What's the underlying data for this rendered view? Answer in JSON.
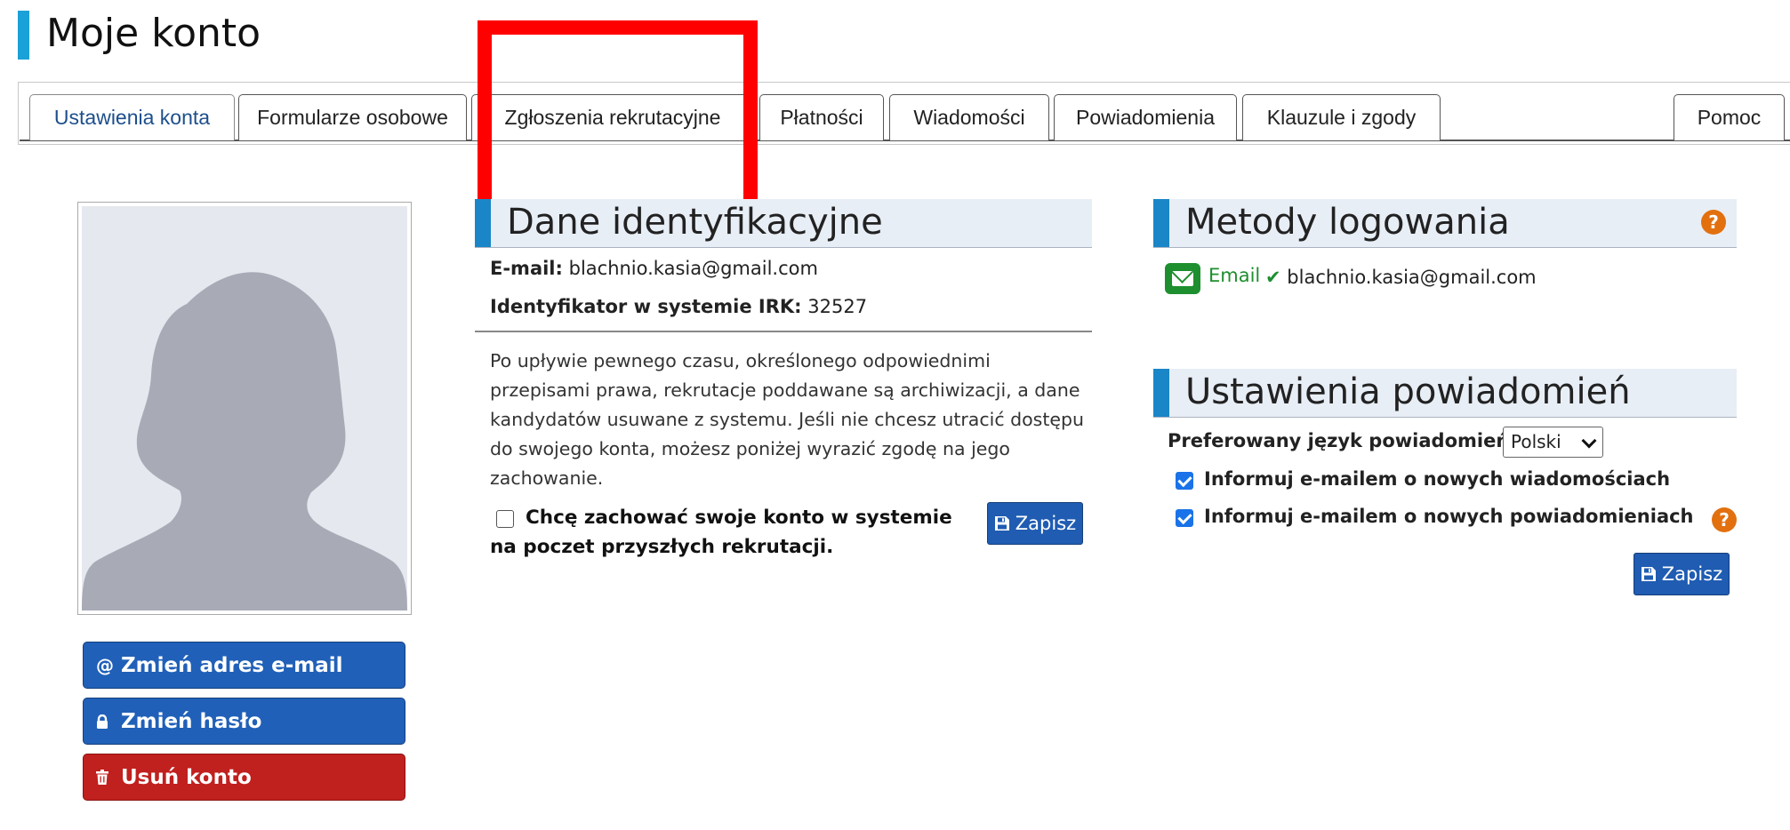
{
  "page_title": "Moje konto",
  "tabs": [
    {
      "label": "Ustawienia konta"
    },
    {
      "label": "Formularze osobowe"
    },
    {
      "label": "Zgłoszenia rekrutacyjne"
    },
    {
      "label": "Płatności"
    },
    {
      "label": "Wiadomości"
    },
    {
      "label": "Powiadomienia"
    },
    {
      "label": "Klauzule i zgody"
    },
    {
      "label": "Pomoc"
    }
  ],
  "left_buttons": {
    "change_email": "Zmień adres e-mail",
    "change_password": "Zmień hasło",
    "delete_account": "Usuń konto"
  },
  "identity": {
    "heading": "Dane identyfikacyjne",
    "email_label": "E-mail:",
    "email_value": "blachnio.kasia@gmail.com",
    "irk_label": "Identyfikator w systemie IRK:",
    "irk_value": "32527",
    "note": "Po upływie pewnego czasu, określonego odpowiednimi przepisami prawa, rekrutacje poddawane są archiwizacji, a dane kandydatów usuwane z systemu. Jeśli nie chcesz utracić dostępu do swojego konta, możesz poniżej wyrazić zgodę na jego zachowanie.",
    "keep_account_label": "Chcę zachować swoje konto w systemie na poczet przyszłych rekrutacji.",
    "keep_account_checked": false,
    "save_label": "Zapisz"
  },
  "login_methods": {
    "heading": "Metody logowania",
    "method_label": "Email",
    "method_value": "blachnio.kasia@gmail.com"
  },
  "notifications": {
    "heading": "Ustawienia powiadomień",
    "language_label": "Preferowany język powiadomień:",
    "language_selected": "Polski",
    "email_new_messages_label": "Informuj e-mailem o nowych wiadomościach",
    "email_new_messages_checked": true,
    "email_new_notifications_label": "Informuj e-mailem o nowych powiadomieniach",
    "email_new_notifications_checked": true,
    "save_label": "Zapisz"
  },
  "colors": {
    "accent_blue": "#2060b8",
    "danger_red": "#c0201e",
    "heading_bar": "#1a86c8",
    "success_green": "#1e8f2e",
    "help_orange": "#e2700f"
  }
}
